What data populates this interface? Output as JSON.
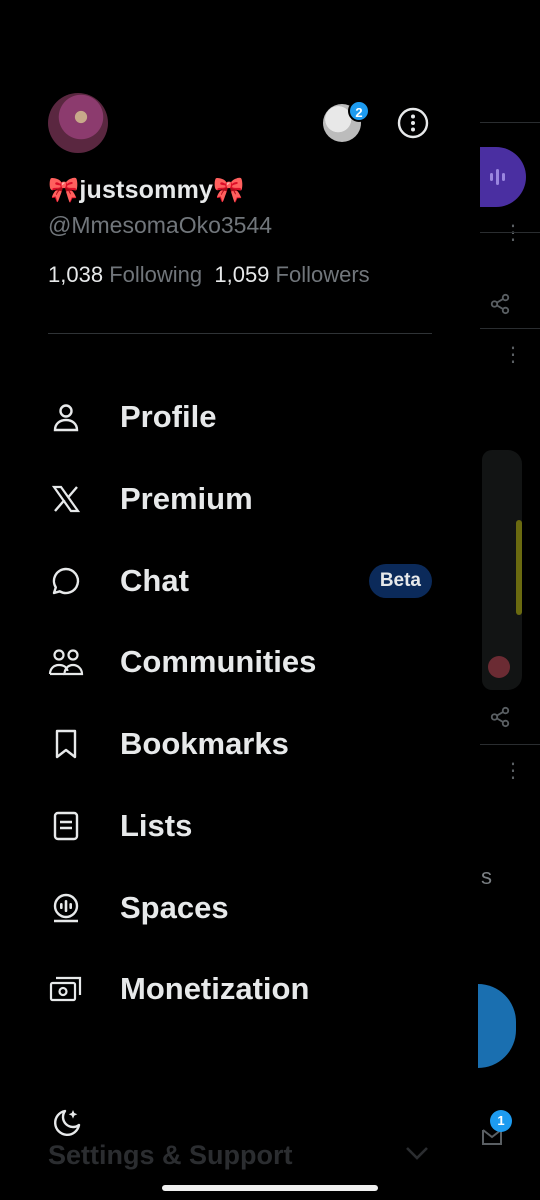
{
  "profile": {
    "display_name": "🎀justsommy🎀",
    "handle": "@MmesomaOko3544",
    "following_count": "1,038",
    "following_label": "Following",
    "followers_count": "1,059",
    "followers_label": "Followers",
    "account_badge": "2"
  },
  "menu": [
    {
      "label": "Profile",
      "icon": "person-icon"
    },
    {
      "label": "Premium",
      "icon": "x-logo-icon"
    },
    {
      "label": "Chat",
      "icon": "chat-bubble-icon",
      "badge": "Beta"
    },
    {
      "label": "Communities",
      "icon": "communities-icon"
    },
    {
      "label": "Bookmarks",
      "icon": "bookmark-icon"
    },
    {
      "label": "Lists",
      "icon": "list-icon"
    },
    {
      "label": "Spaces",
      "icon": "spaces-icon"
    },
    {
      "label": "Monetization",
      "icon": "money-icon"
    }
  ],
  "settings": {
    "label": "Settings & Support",
    "icon": "moon-sparkle-icon"
  },
  "background": {
    "partial_text": "s",
    "message_badge": "1"
  },
  "colors": {
    "accent": "#1d9bf0",
    "beta_bg": "#0b2a5a",
    "muted_text": "#71767b",
    "background": "#000000"
  }
}
